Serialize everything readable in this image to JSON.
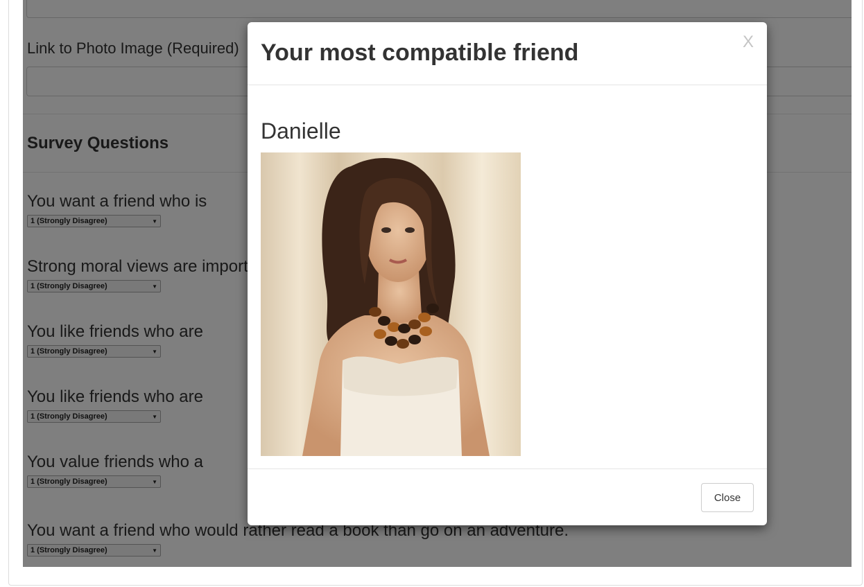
{
  "form": {
    "photo_label": "Link to Photo Image (Required)",
    "section_title": "Survey Questions",
    "questions": [
      {
        "text": "You want a friend who is",
        "selected": "1 (Strongly Disagree)"
      },
      {
        "text": "Strong moral views are important to you.",
        "selected": "1 (Strongly Disagree)"
      },
      {
        "text": "You like friends who are",
        "selected": "1 (Strongly Disagree)"
      },
      {
        "text": "You like friends who are",
        "selected": "1 (Strongly Disagree)"
      },
      {
        "text": "You value friends who a",
        "selected": "1 (Strongly Disagree)"
      },
      {
        "text": "You want a friend who would rather read a book than go on an adventure.",
        "selected": "1 (Strongly Disagree)"
      }
    ]
  },
  "modal": {
    "title": "Your most compatible friend",
    "close_x": "X",
    "friend_name": "Danielle",
    "close_button": "Close"
  },
  "icons": {
    "select_arrow": "triangle-down-icon",
    "close": "close-icon"
  },
  "colors": {
    "backdrop": "#000000",
    "modal_bg": "#ffffff",
    "text": "#333333"
  }
}
